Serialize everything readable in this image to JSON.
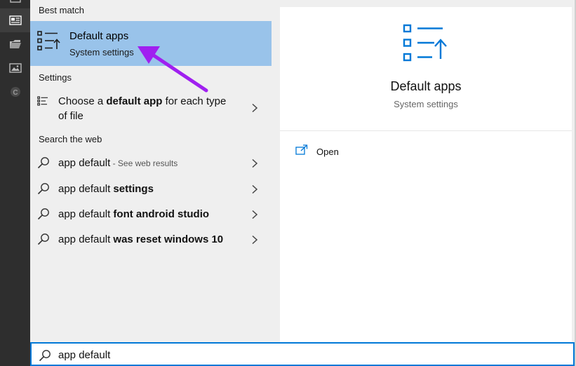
{
  "rail": {
    "icons": [
      "tile-icon",
      "news-icon",
      "folder-icon",
      "image-icon",
      "cortana-icon"
    ]
  },
  "results": {
    "best_match": {
      "heading": "Best match",
      "title": "Default apps",
      "subtitle": "System settings",
      "icon": "default-apps-icon"
    },
    "settings": {
      "heading": "Settings",
      "items": [
        {
          "line1_pre": "Choose a ",
          "line1_bold": "default app",
          "line1_post": " for each type",
          "line2": "of file",
          "icon": "settings-list-icon"
        }
      ]
    },
    "web": {
      "heading": "Search the web",
      "items": [
        {
          "query": "app default",
          "bold": "",
          "hint": " - See web results"
        },
        {
          "query": "app default ",
          "bold": "settings",
          "hint": ""
        },
        {
          "query": "app default ",
          "bold": "font android studio",
          "hint": ""
        },
        {
          "query": "app default ",
          "bold": "was reset windows 10",
          "hint": ""
        }
      ]
    }
  },
  "preview": {
    "title": "Default apps",
    "subtitle": "System settings",
    "actions": [
      {
        "label": "Open",
        "icon": "open-external-icon"
      }
    ]
  },
  "search": {
    "value": "app default",
    "icon": "search-icon"
  },
  "colors": {
    "highlight": "#99c3ea",
    "accent": "#0078d7",
    "annotation": "#a020f0"
  }
}
